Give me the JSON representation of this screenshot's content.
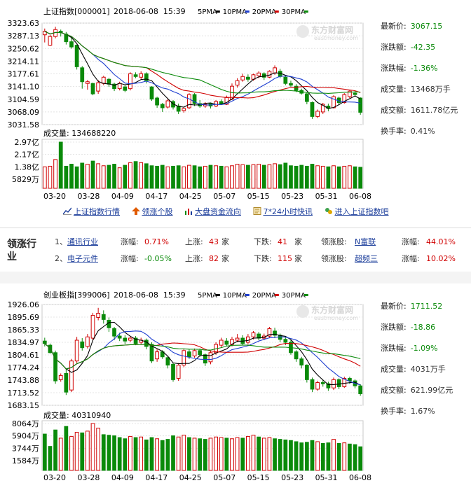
{
  "panels": [
    {
      "id": "sh",
      "header": {
        "title": "上证指数[000001]",
        "datetime": "2018-06-08  15:39",
        "ma": [
          {
            "label": "5PMA",
            "color": "#000000"
          },
          {
            "label": "10PMA",
            "color": "#1f3fd0"
          },
          {
            "label": "20PMA",
            "color": "#d00000"
          },
          {
            "label": "30PMA",
            "color": "#0a8a0a"
          }
        ]
      },
      "watermark": {
        "name": "东方财富网",
        "url": "eastmoney.com"
      },
      "price_axis": [
        "3323.63",
        "3287.13",
        "3250.62",
        "3214.11",
        "3177.61",
        "3141.10",
        "3104.59",
        "3068.09",
        "3031.58"
      ],
      "volume": {
        "label": "成交量: 134688220",
        "axis": [
          "2.97亿",
          "2.17亿",
          "1.38亿",
          "5829万"
        ]
      },
      "dates": [
        "03-20",
        "03-28",
        "04-09",
        "04-17",
        "04-25",
        "05-07",
        "05-15",
        "05-23",
        "05-31",
        "06-08"
      ],
      "stats": [
        {
          "label": "最新价:",
          "value": "3067.15",
          "color": "down"
        },
        {
          "label": "涨跌额:",
          "value": "-42.35",
          "color": "down"
        },
        {
          "label": "涨跌幅:",
          "value": "-1.36%",
          "color": "down"
        },
        {
          "label": "成交量:",
          "value": "13468万手",
          "color": "normal"
        },
        {
          "label": "成交额:",
          "value": "1611.78亿元",
          "color": "normal"
        },
        {
          "label": "换手率:",
          "value": "0.41%",
          "color": "normal"
        }
      ]
    },
    {
      "id": "cy",
      "header": {
        "title": "创业板指[399006]",
        "datetime": "2018-06-08  15:39",
        "ma": [
          {
            "label": "5PMA",
            "color": "#000000"
          },
          {
            "label": "10PMA",
            "color": "#1f3fd0"
          },
          {
            "label": "20PMA",
            "color": "#d00000"
          },
          {
            "label": "30PMA",
            "color": "#0a8a0a"
          }
        ]
      },
      "watermark": {
        "name": "东方财富网",
        "url": "eastmoney.com"
      },
      "price_axis": [
        "1926.06",
        "1895.69",
        "1865.33",
        "1834.97",
        "1804.61",
        "1774.24",
        "1743.88",
        "1713.52",
        "1683.15"
      ],
      "volume": {
        "label": "成交量: 40310940",
        "axis": [
          "8064万",
          "5904万",
          "3744万",
          "1584万"
        ]
      },
      "dates": [
        "03-20",
        "03-28",
        "04-09",
        "04-17",
        "04-25",
        "05-07",
        "05-15",
        "05-23",
        "05-31",
        "06-08"
      ],
      "stats": [
        {
          "label": "最新价:",
          "value": "1711.52",
          "color": "down"
        },
        {
          "label": "涨跌额:",
          "value": "-18.86",
          "color": "down"
        },
        {
          "label": "涨跌幅:",
          "value": "-1.09%",
          "color": "down"
        },
        {
          "label": "成交量:",
          "value": "4031万手",
          "color": "normal"
        },
        {
          "label": "成交额:",
          "value": "621.99亿元",
          "color": "normal"
        },
        {
          "label": "换手率:",
          "value": "1.67%",
          "color": "normal"
        }
      ]
    }
  ],
  "links": [
    {
      "label": "上证指数行情",
      "icon": "chart-line-icon"
    },
    {
      "label": "领涨个股",
      "icon": "arrow-up-icon"
    },
    {
      "label": "大盘资金流向",
      "icon": "bar-chart-icon"
    },
    {
      "label": "7*24小时快讯",
      "icon": "news-icon"
    },
    {
      "label": "进入上证指数吧",
      "icon": "forum-icon"
    }
  ],
  "sector": {
    "title": "领涨行业",
    "rows": [
      {
        "idx": "1、",
        "name": "通讯行业",
        "chg_label": "涨幅:",
        "chg": "0.71%",
        "up_label": "上涨:",
        "up": "43",
        "up_unit": "家",
        "down_label": "下跌:",
        "down": "41",
        "down_unit": "家",
        "lead_label": "领涨股:",
        "lead": "N富联",
        "lead_chg_label": "涨幅:",
        "lead_chg": "44.01%"
      },
      {
        "idx": "2、",
        "name": "电子元件",
        "chg_label": "涨幅:",
        "chg": "-0.05%",
        "up_label": "上涨:",
        "up": "82",
        "up_unit": "家",
        "down_label": "下跌:",
        "down": "115",
        "down_unit": "家",
        "lead_label": "领涨股:",
        "lead": "超频三",
        "lead_chg_label": "涨幅:",
        "lead_chg": "10.02%"
      }
    ]
  },
  "chart_data": [
    {
      "type": "candlestick",
      "title": "上证指数[000001]",
      "ylim": [
        3031.58,
        3323.63
      ],
      "dates": [
        "03-20",
        "03-28",
        "04-09",
        "04-17",
        "04-25",
        "05-07",
        "05-15",
        "05-23",
        "05-31",
        "06-08"
      ],
      "candles": [
        [
          3290,
          3300,
          3268,
          3308
        ],
        [
          3260,
          3285,
          3258,
          3290
        ],
        [
          3285,
          3305,
          3280,
          3313
        ],
        [
          3300,
          3296,
          3285,
          3305
        ],
        [
          3292,
          3270,
          3262,
          3298
        ],
        [
          3270,
          3255,
          3250,
          3282
        ],
        [
          3260,
          3198,
          3190,
          3262
        ],
        [
          3195,
          3155,
          3135,
          3200
        ],
        [
          3150,
          3155,
          3132,
          3160
        ],
        [
          3150,
          3120,
          3116,
          3152
        ],
        [
          3128,
          3152,
          3120,
          3160
        ],
        [
          3150,
          3168,
          3145,
          3172
        ],
        [
          3162,
          3148,
          3140,
          3166
        ],
        [
          3148,
          3135,
          3128,
          3152
        ],
        [
          3135,
          3150,
          3130,
          3155
        ],
        [
          3140,
          3130,
          3125,
          3145
        ],
        [
          3135,
          3178,
          3130,
          3182
        ],
        [
          3175,
          3170,
          3165,
          3182
        ],
        [
          3168,
          3178,
          3162,
          3185
        ],
        [
          3178,
          3158,
          3150,
          3182
        ],
        [
          3140,
          3105,
          3100,
          3142
        ],
        [
          3108,
          3088,
          3080,
          3112
        ],
        [
          3090,
          3080,
          3068,
          3094
        ],
        [
          3082,
          3100,
          3078,
          3105
        ],
        [
          3098,
          3082,
          3075,
          3102
        ],
        [
          3085,
          3070,
          3062,
          3092
        ],
        [
          3072,
          3078,
          3066,
          3082
        ],
        [
          3080,
          3118,
          3076,
          3122
        ],
        [
          3118,
          3092,
          3085,
          3122
        ],
        [
          3092,
          3085,
          3080,
          3102
        ],
        [
          3085,
          3090,
          3080,
          3096
        ],
        [
          3092,
          3085,
          3078,
          3095
        ],
        [
          3085,
          3098,
          3082,
          3102
        ],
        [
          3098,
          3092,
          3088,
          3104
        ],
        [
          3090,
          3110,
          3088,
          3115
        ],
        [
          3105,
          3142,
          3102,
          3150
        ],
        [
          3145,
          3158,
          3138,
          3165
        ],
        [
          3160,
          3170,
          3155,
          3178
        ],
        [
          3168,
          3162,
          3155,
          3176
        ],
        [
          3162,
          3175,
          3158,
          3178
        ],
        [
          3172,
          3180,
          3165,
          3185
        ],
        [
          3178,
          3168,
          3160,
          3182
        ],
        [
          3168,
          3185,
          3165,
          3188
        ],
        [
          3180,
          3195,
          3175,
          3202
        ],
        [
          3185,
          3170,
          3165,
          3192
        ],
        [
          3168,
          3150,
          3145,
          3172
        ],
        [
          3150,
          3145,
          3140,
          3158
        ],
        [
          3142,
          3130,
          3125,
          3148
        ],
        [
          3130,
          3122,
          3118,
          3135
        ],
        [
          3120,
          3098,
          3090,
          3124
        ],
        [
          3095,
          3055,
          3048,
          3098
        ],
        [
          3055,
          3070,
          3050,
          3075
        ],
        [
          3068,
          3090,
          3062,
          3094
        ],
        [
          3085,
          3078,
          3070,
          3092
        ],
        [
          3080,
          3112,
          3078,
          3116
        ],
        [
          3108,
          3095,
          3088,
          3112
        ],
        [
          3095,
          3118,
          3092,
          3122
        ],
        [
          3112,
          3128,
          3108,
          3132
        ],
        [
          3122,
          3118,
          3112,
          3128
        ],
        [
          3108,
          3067,
          3060,
          3110
        ]
      ],
      "volume": [
        1.38,
        1.42,
        1.85,
        2.97,
        1.42,
        1.55,
        1.38,
        1.62,
        1.55,
        1.75,
        1.58,
        1.45,
        1.48,
        1.55,
        1.32,
        1.48,
        1.65,
        1.72,
        1.65,
        1.58,
        1.45,
        1.42,
        1.48,
        1.38,
        1.42,
        1.45,
        1.38,
        1.48,
        1.45,
        1.38,
        1.42,
        1.48,
        1.45,
        1.42,
        1.38,
        1.45,
        1.55,
        1.52,
        1.48,
        1.52,
        1.55,
        1.48,
        1.52,
        1.58,
        1.52,
        1.62,
        1.45,
        1.42,
        1.48,
        1.42,
        1.55,
        1.45,
        1.42,
        1.38,
        1.45,
        1.38,
        1.42,
        1.45,
        1.38,
        1.35
      ],
      "volume_unit": "亿"
    },
    {
      "type": "candlestick",
      "title": "创业板指[399006]",
      "ylim": [
        1683.15,
        1926.06
      ],
      "dates": [
        "03-20",
        "03-28",
        "04-09",
        "04-17",
        "04-25",
        "05-07",
        "05-15",
        "05-23",
        "05-31",
        "06-08"
      ],
      "candles": [
        [
          1838,
          1832,
          1825,
          1846
        ],
        [
          1828,
          1810,
          1808,
          1832
        ],
        [
          1810,
          1742,
          1735,
          1815
        ],
        [
          1745,
          1755,
          1740,
          1760
        ],
        [
          1760,
          1715,
          1708,
          1770
        ],
        [
          1720,
          1790,
          1715,
          1795
        ],
        [
          1790,
          1840,
          1785,
          1848
        ],
        [
          1836,
          1822,
          1815,
          1845
        ],
        [
          1825,
          1848,
          1820,
          1855
        ],
        [
          1845,
          1900,
          1840,
          1906
        ],
        [
          1895,
          1905,
          1888,
          1918
        ],
        [
          1902,
          1890,
          1880,
          1912
        ],
        [
          1888,
          1870,
          1860,
          1895
        ],
        [
          1868,
          1850,
          1840,
          1872
        ],
        [
          1850,
          1845,
          1838,
          1858
        ],
        [
          1845,
          1838,
          1830,
          1852
        ],
        [
          1840,
          1845,
          1835,
          1850
        ],
        [
          1845,
          1832,
          1828,
          1850
        ],
        [
          1835,
          1840,
          1830,
          1846
        ],
        [
          1840,
          1825,
          1818,
          1844
        ],
        [
          1830,
          1790,
          1785,
          1835
        ],
        [
          1795,
          1812,
          1788,
          1818
        ],
        [
          1812,
          1800,
          1795,
          1816
        ],
        [
          1798,
          1780,
          1772,
          1802
        ],
        [
          1782,
          1745,
          1740,
          1786
        ],
        [
          1748,
          1780,
          1742,
          1785
        ],
        [
          1780,
          1815,
          1775,
          1820
        ],
        [
          1812,
          1800,
          1795,
          1818
        ],
        [
          1802,
          1815,
          1798,
          1820
        ],
        [
          1815,
          1805,
          1800,
          1820
        ],
        [
          1805,
          1785,
          1778,
          1808
        ],
        [
          1788,
          1810,
          1782,
          1815
        ],
        [
          1810,
          1830,
          1805,
          1835
        ],
        [
          1828,
          1840,
          1822,
          1846
        ],
        [
          1838,
          1830,
          1825,
          1845
        ],
        [
          1830,
          1842,
          1825,
          1848
        ],
        [
          1840,
          1845,
          1835,
          1855
        ],
        [
          1845,
          1832,
          1828,
          1852
        ],
        [
          1835,
          1848,
          1830,
          1855
        ],
        [
          1848,
          1858,
          1842,
          1862
        ],
        [
          1855,
          1845,
          1840,
          1860
        ],
        [
          1845,
          1850,
          1840,
          1856
        ],
        [
          1850,
          1868,
          1845,
          1872
        ],
        [
          1862,
          1852,
          1845,
          1870
        ],
        [
          1852,
          1842,
          1835,
          1856
        ],
        [
          1842,
          1835,
          1828,
          1848
        ],
        [
          1835,
          1810,
          1805,
          1840
        ],
        [
          1812,
          1795,
          1788,
          1816
        ],
        [
          1795,
          1780,
          1772,
          1800
        ],
        [
          1780,
          1745,
          1738,
          1782
        ],
        [
          1745,
          1722,
          1715,
          1750
        ],
        [
          1722,
          1738,
          1718,
          1742
        ],
        [
          1738,
          1735,
          1728,
          1745
        ],
        [
          1735,
          1725,
          1718,
          1740
        ],
        [
          1725,
          1745,
          1720,
          1750
        ],
        [
          1745,
          1728,
          1722,
          1748
        ],
        [
          1728,
          1748,
          1725,
          1752
        ],
        [
          1748,
          1742,
          1735,
          1752
        ],
        [
          1742,
          1730,
          1724,
          1746
        ],
        [
          1730,
          1711,
          1706,
          1734
        ]
      ],
      "volume": [
        6200,
        4100,
        6900,
        5500,
        7500,
        5800,
        6500,
        6400,
        6700,
        8000,
        7200,
        6100,
        6000,
        5900,
        5600,
        5400,
        5800,
        5600,
        5700,
        5200,
        5600,
        5400,
        5100,
        5300,
        5900,
        5700,
        6000,
        5600,
        5500,
        5400,
        5300,
        5500,
        5700,
        5600,
        5500,
        5400,
        5600,
        5500,
        5800,
        6000,
        5700,
        5500,
        5600,
        5400,
        5300,
        5200,
        5100,
        4900,
        4700,
        4800,
        5100,
        4900,
        4600,
        4700,
        5300,
        4600,
        4700,
        4500,
        4400,
        4031
      ],
      "volume_unit": "万"
    }
  ]
}
